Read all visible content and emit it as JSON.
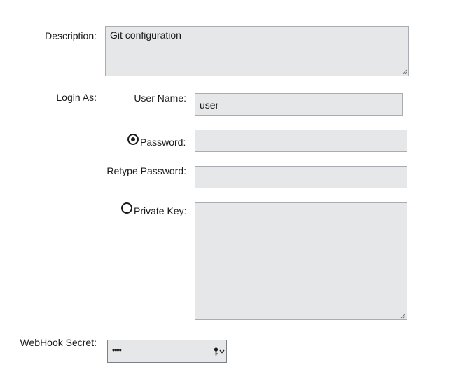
{
  "description": {
    "label": "Description:",
    "value": "Git configuration"
  },
  "login": {
    "label": "Login As:",
    "username_label": "User Name:",
    "username_value": "user",
    "password_label": "Password:",
    "retype_label": "Retype Password:",
    "private_key_label": "Private Key:",
    "selected_auth": "password"
  },
  "webhook": {
    "label": "WebHook Secret:",
    "value": "••••",
    "icons": [
      "key-icon",
      "chevron-down-icon"
    ]
  }
}
